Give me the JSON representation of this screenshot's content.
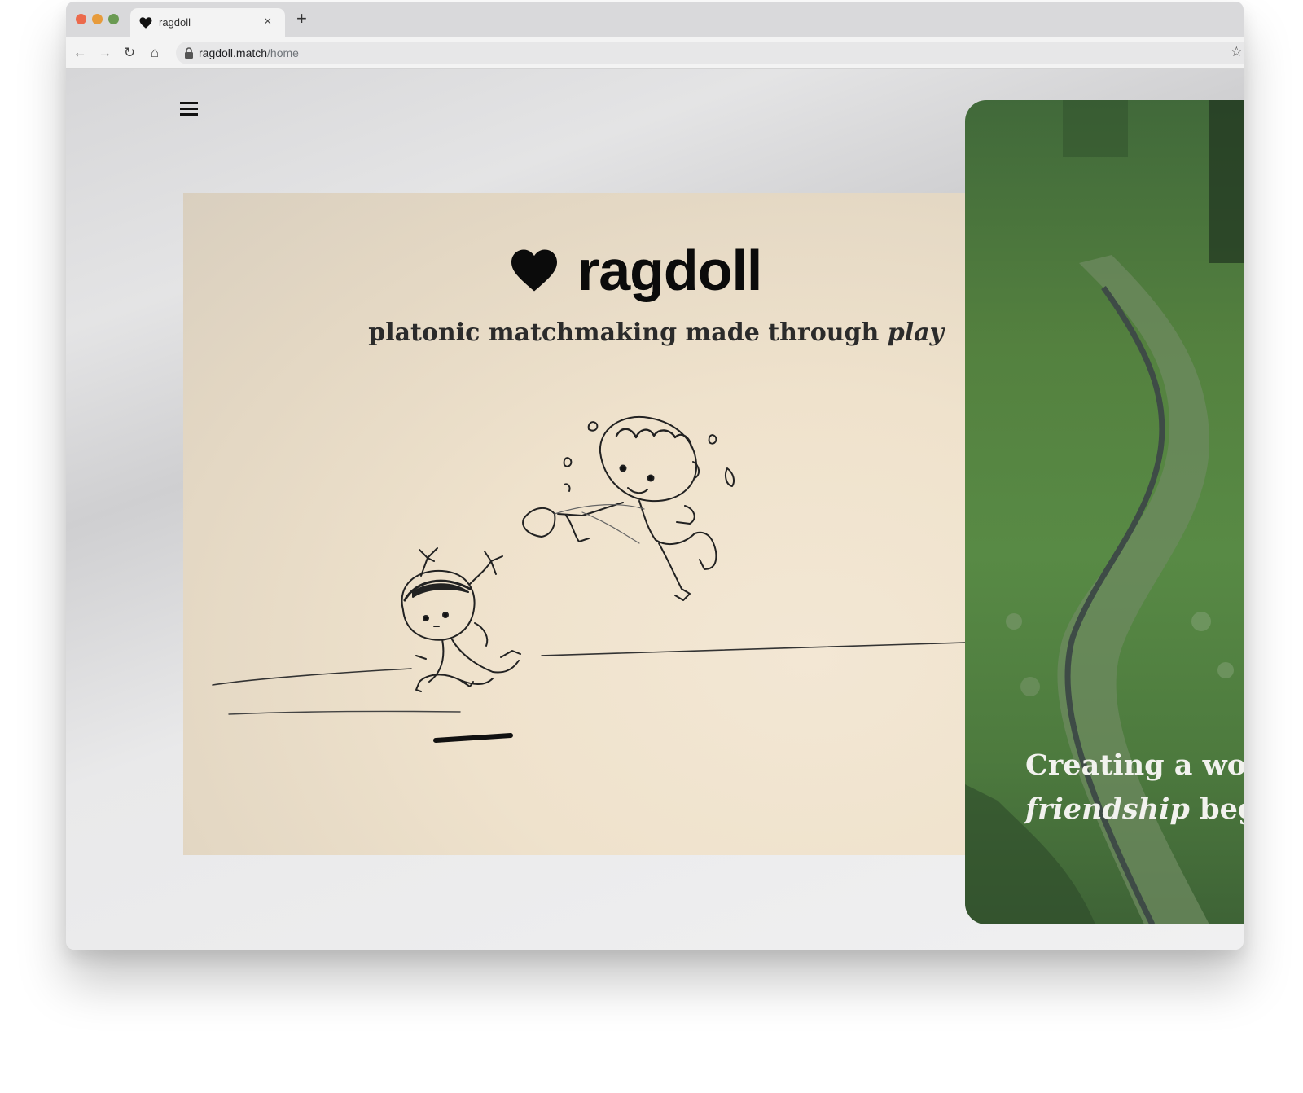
{
  "browser": {
    "tab": {
      "title": "ragdoll",
      "close_glyph": "×",
      "favicon": "heart-icon"
    },
    "new_tab_glyph": "+",
    "toolbar": {
      "back_glyph": "←",
      "forward_glyph": "→",
      "reload_glyph": "↻",
      "home_glyph": "⌂",
      "url_host": "ragdoll.match",
      "url_path": "/home",
      "bookmark_glyph": "☆",
      "menu_glyph": "⋮"
    }
  },
  "page": {
    "menu_icon": "hamburger-icon",
    "hero": {
      "brand_name": "ragdoll",
      "brand_icon": "heart-icon",
      "tagline_main": "platonic matchmaking made through ",
      "tagline_emphasis": "play"
    },
    "side_card": {
      "line1": "Creating a wor",
      "line2_emphasis": "friendship",
      "line2_rest": " beg"
    }
  },
  "colors": {
    "traffic_red": "#ec6a4c",
    "traffic_yellow": "#e79b3b",
    "traffic_green": "#6a9a52",
    "hero_paper": "#efe2cc",
    "side_card_green": "#54813f",
    "text_dark": "#0b0b0b"
  }
}
